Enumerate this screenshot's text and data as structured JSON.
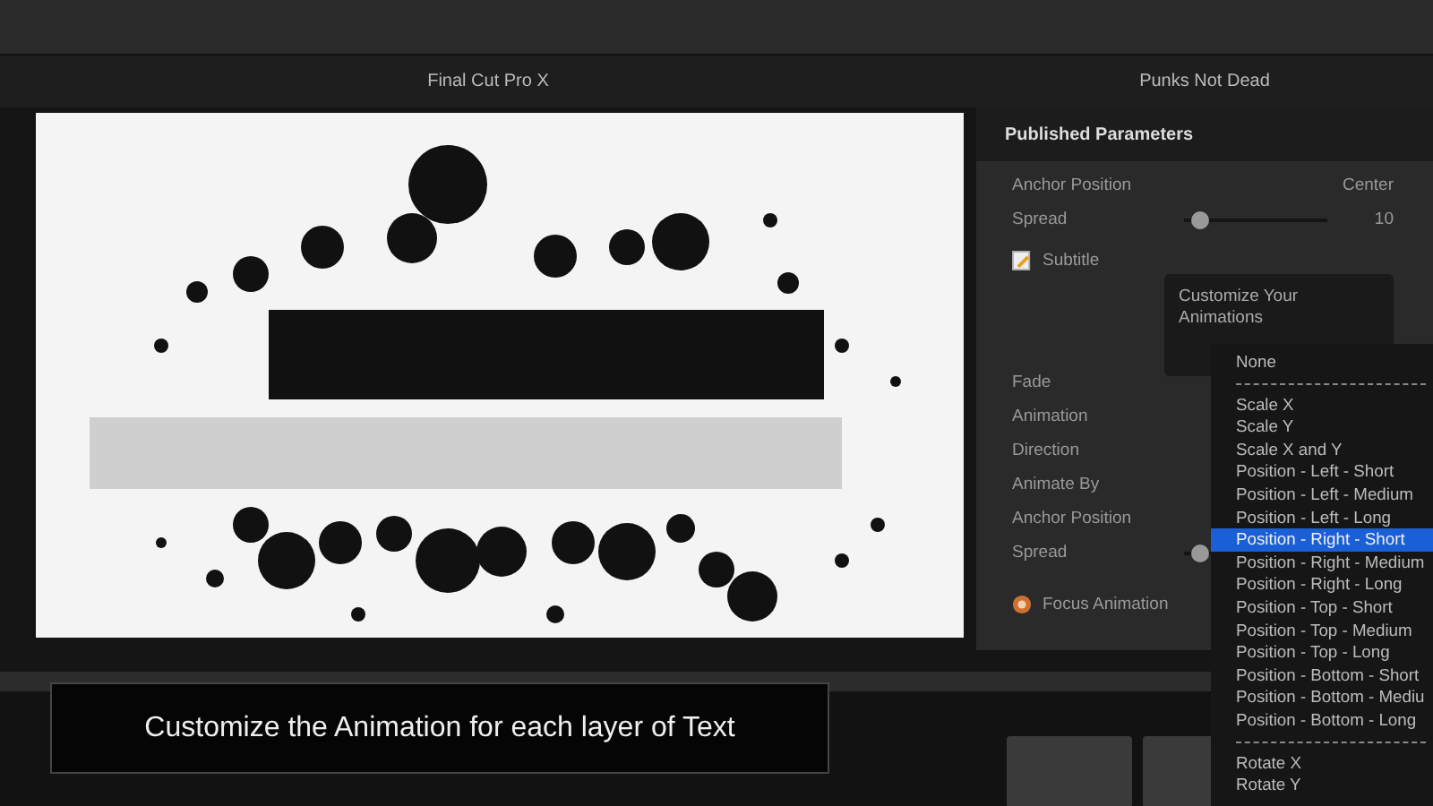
{
  "viewer": {
    "title": "Final Cut Pro X"
  },
  "inspector": {
    "title": "Punks Not Dead",
    "section": "Published Parameters",
    "rows": [
      {
        "kind": "value",
        "label": "Anchor Position",
        "value": "Center"
      },
      {
        "kind": "slider",
        "label": "Spread",
        "level": 0.05,
        "reading": "10"
      },
      {
        "kind": "layer",
        "label": "Subtitle"
      },
      {
        "kind": "label",
        "label": "Fade"
      },
      {
        "kind": "label",
        "label": "Animation"
      },
      {
        "kind": "label",
        "label": "Direction"
      },
      {
        "kind": "label",
        "label": "Animate By"
      },
      {
        "kind": "label",
        "label": "Anchor Position"
      },
      {
        "kind": "slider",
        "label": "Spread",
        "level": 0.05
      },
      {
        "kind": "focus",
        "label": "Focus Animation"
      }
    ]
  },
  "tooltip": {
    "text": "Customize Your Animations"
  },
  "menu": {
    "items": [
      {
        "kind": "item",
        "label": "None",
        "selected": false
      },
      {
        "kind": "separator"
      },
      {
        "kind": "item",
        "label": "Scale X",
        "selected": false
      },
      {
        "kind": "item",
        "label": "Scale Y",
        "selected": false
      },
      {
        "kind": "item",
        "label": "Scale X and Y",
        "selected": false
      },
      {
        "kind": "item",
        "label": "Position - Left - Short",
        "selected": false
      },
      {
        "kind": "item",
        "label": "Position - Left - Medium",
        "selected": false
      },
      {
        "kind": "item",
        "label": "Position - Left - Long",
        "selected": false
      },
      {
        "kind": "item",
        "label": "Position - Right - Short",
        "selected": true
      },
      {
        "kind": "item",
        "label": "Position - Right - Medium",
        "selected": false
      },
      {
        "kind": "item",
        "label": "Position - Right - Long",
        "selected": false
      },
      {
        "kind": "item",
        "label": "Position - Top - Short",
        "selected": false
      },
      {
        "kind": "item",
        "label": "Position - Top - Medium",
        "selected": false
      },
      {
        "kind": "item",
        "label": "Position - Top - Long",
        "selected": false
      },
      {
        "kind": "item",
        "label": "Position - Bottom - Short",
        "selected": false
      },
      {
        "kind": "item",
        "label": "Position - Bottom - Mediu",
        "selected": false
      },
      {
        "kind": "item",
        "label": "Position - Bottom - Long",
        "selected": false
      },
      {
        "kind": "separator"
      },
      {
        "kind": "item",
        "label": "Rotate X",
        "selected": false
      },
      {
        "kind": "item",
        "label": "Rotate Y",
        "selected": false
      }
    ]
  },
  "caption": {
    "text": "Customize the Animation for each layer of Text"
  }
}
